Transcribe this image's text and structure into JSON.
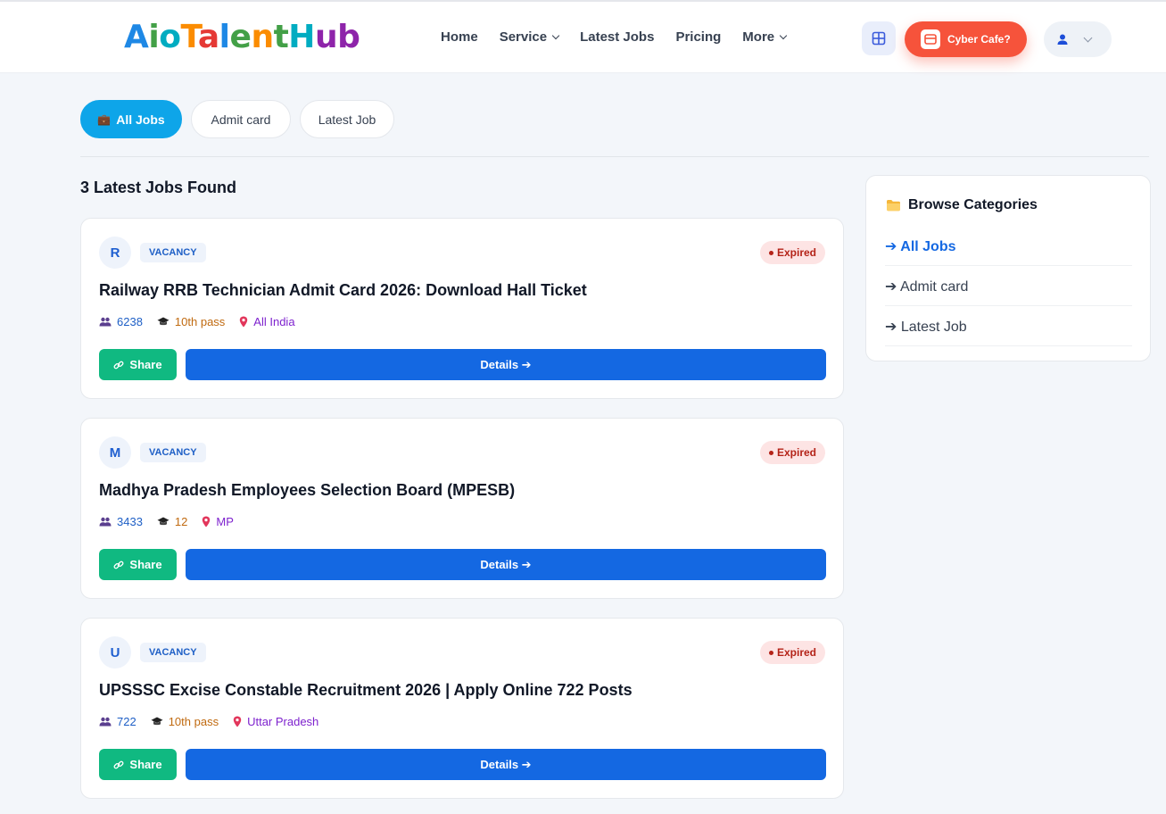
{
  "header": {
    "logo": {
      "parts": [
        {
          "text": "A",
          "color": "#1e88e5"
        },
        {
          "text": "i",
          "color": "#43a047"
        },
        {
          "text": "o",
          "color": "#00acc1"
        },
        {
          "text": "T",
          "color": "#fb8c00"
        },
        {
          "text": "a",
          "color": "#e53935"
        },
        {
          "text": "l",
          "color": "#1e88e5"
        },
        {
          "text": "e",
          "color": "#43a047"
        },
        {
          "text": "n",
          "color": "#fb8c00"
        },
        {
          "text": "t",
          "color": "#43a047"
        },
        {
          "text": "H",
          "color": "#00acc1"
        },
        {
          "text": "u",
          "color": "#8e24aa"
        },
        {
          "text": "b",
          "color": "#8e24aa"
        }
      ]
    },
    "nav": [
      {
        "label": "Home",
        "dropdown": false
      },
      {
        "label": "Service",
        "dropdown": true
      },
      {
        "label": "Latest Jobs",
        "dropdown": false
      },
      {
        "label": "Pricing",
        "dropdown": false
      },
      {
        "label": "More",
        "dropdown": true
      }
    ],
    "cyber_label": "Cyber Cafe?",
    "grid_icon": "grid-icon",
    "user_icon": "user-icon"
  },
  "tabs": [
    {
      "label": "All Jobs",
      "icon": "💼",
      "active": true
    },
    {
      "label": "Admit card",
      "active": false
    },
    {
      "label": "Latest Job",
      "active": false
    }
  ],
  "found_text": "3 Latest Jobs Found",
  "jobs": [
    {
      "letter": "R",
      "tag": "VACANCY",
      "status": "Expired",
      "title": "Railway RRB Technician Admit Card 2026: Download Hall Ticket",
      "posts": "6238",
      "qualification": "10th pass",
      "location": "All India",
      "share_label": "Share",
      "details_label": "Details ➔"
    },
    {
      "letter": "M",
      "tag": "VACANCY",
      "status": "Expired",
      "title": "Madhya Pradesh Employees Selection Board (MPESB)",
      "posts": "3433",
      "qualification": "12",
      "location": "MP",
      "share_label": "Share",
      "details_label": "Details ➔"
    },
    {
      "letter": "U",
      "tag": "VACANCY",
      "status": "Expired",
      "title": "UPSSSC Excise Constable Recruitment 2026 | Apply Online 722 Posts",
      "posts": "722",
      "qualification": "10th pass",
      "location": "Uttar Pradesh",
      "share_label": "Share",
      "details_label": "Details ➔"
    }
  ],
  "sidebar": {
    "title": "Browse Categories",
    "items": [
      {
        "label": "➔ All Jobs",
        "active": true
      },
      {
        "label": "➔ Admit card",
        "active": false
      },
      {
        "label": "➔ Latest Job",
        "active": false
      }
    ]
  },
  "colors": {
    "accent_blue": "#1468e2",
    "tab_active": "#0ea5e9",
    "share_green": "#10b981",
    "cyber_orange": "#f6533b",
    "expired_red": "#b42318"
  }
}
